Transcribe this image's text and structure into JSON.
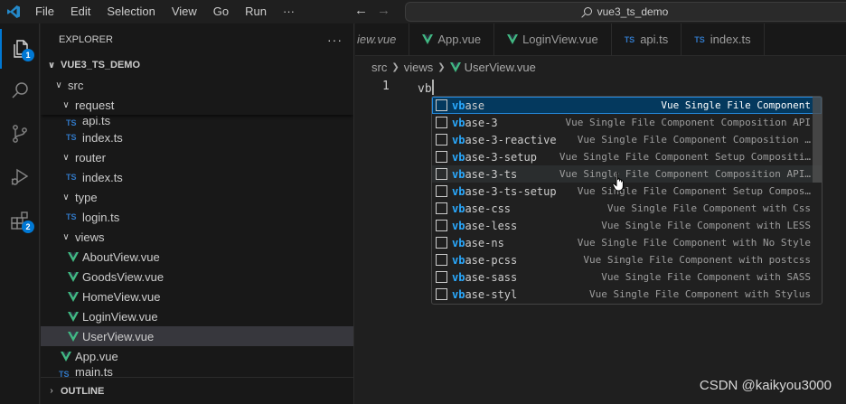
{
  "menu": [
    "File",
    "Edit",
    "Selection",
    "View",
    "Go",
    "Run",
    "···"
  ],
  "command_center": "vue3_ts_demo",
  "activity": {
    "explorer_badge": "1",
    "extensions_badge": "2"
  },
  "sidebar": {
    "title": "EXPLORER",
    "more": "···",
    "project": "VUE3_TS_DEMO",
    "outline": "OUTLINE"
  },
  "tree": [
    {
      "label": "src",
      "kind": "folder",
      "indent": 1
    },
    {
      "label": "request",
      "kind": "folder",
      "indent": 2,
      "sticky": true
    },
    {
      "label": "api.ts",
      "kind": "ts",
      "indent": 3,
      "partial": true
    },
    {
      "label": "index.ts",
      "kind": "ts",
      "indent": 3
    },
    {
      "label": "router",
      "kind": "folder",
      "indent": 2
    },
    {
      "label": "index.ts",
      "kind": "ts",
      "indent": 3
    },
    {
      "label": "type",
      "kind": "folder",
      "indent": 2
    },
    {
      "label": "login.ts",
      "kind": "ts",
      "indent": 3
    },
    {
      "label": "views",
      "kind": "folder",
      "indent": 2
    },
    {
      "label": "AboutView.vue",
      "kind": "vue",
      "indent": 3
    },
    {
      "label": "GoodsView.vue",
      "kind": "vue",
      "indent": 3
    },
    {
      "label": "HomeView.vue",
      "kind": "vue",
      "indent": 3
    },
    {
      "label": "LoginView.vue",
      "kind": "vue",
      "indent": 3
    },
    {
      "label": "UserView.vue",
      "kind": "vue",
      "indent": 3,
      "selected": true
    },
    {
      "label": "App.vue",
      "kind": "vue",
      "indent": 2
    },
    {
      "label": "main.ts",
      "kind": "ts",
      "indent": 2,
      "partial": true
    }
  ],
  "tabs": [
    {
      "label": "iew.vue",
      "kind": "none",
      "italic": true
    },
    {
      "label": "App.vue",
      "kind": "vue"
    },
    {
      "label": "LoginView.vue",
      "kind": "vue"
    },
    {
      "label": "api.ts",
      "kind": "ts"
    },
    {
      "label": "index.ts",
      "kind": "ts"
    }
  ],
  "breadcrumb": {
    "parts": [
      "src",
      "views"
    ],
    "file": "UserView.vue"
  },
  "editor": {
    "line_number": "1",
    "text": "vb"
  },
  "suggestions": [
    {
      "match": "vb",
      "rest": "ase",
      "detail": "Vue Single File Component",
      "focused": true
    },
    {
      "match": "vb",
      "rest": "ase-3",
      "detail": "Vue Single File Component Composition API"
    },
    {
      "match": "vb",
      "rest": "ase-3-reactive",
      "detail": "Vue Single File Component Composition …"
    },
    {
      "match": "vb",
      "rest": "ase-3-setup",
      "detail": "Vue Single File Component Setup Compositi…"
    },
    {
      "match": "vb",
      "rest": "ase-3-ts",
      "detail": "Vue Single File Component Composition API…",
      "hovered": true
    },
    {
      "match": "vb",
      "rest": "ase-3-ts-setup",
      "detail": "Vue Single File Component Setup Compos…"
    },
    {
      "match": "vb",
      "rest": "ase-css",
      "detail": "Vue Single File Component with Css"
    },
    {
      "match": "vb",
      "rest": "ase-less",
      "detail": "Vue Single File Component with LESS"
    },
    {
      "match": "vb",
      "rest": "ase-ns",
      "detail": "Vue Single File Component with No Style"
    },
    {
      "match": "vb",
      "rest": "ase-pcss",
      "detail": "Vue Single File Component with postcss"
    },
    {
      "match": "vb",
      "rest": "ase-sass",
      "detail": "Vue Single File Component with SASS"
    },
    {
      "match": "vb",
      "rest": "ase-styl",
      "detail": "Vue Single File Component with Stylus"
    }
  ],
  "watermark": "CSDN @kaikyou3000",
  "colors": {
    "accent": "#0078d4",
    "vue": "#41b883",
    "ts": "#3178c6",
    "match": "#2aaaff"
  }
}
